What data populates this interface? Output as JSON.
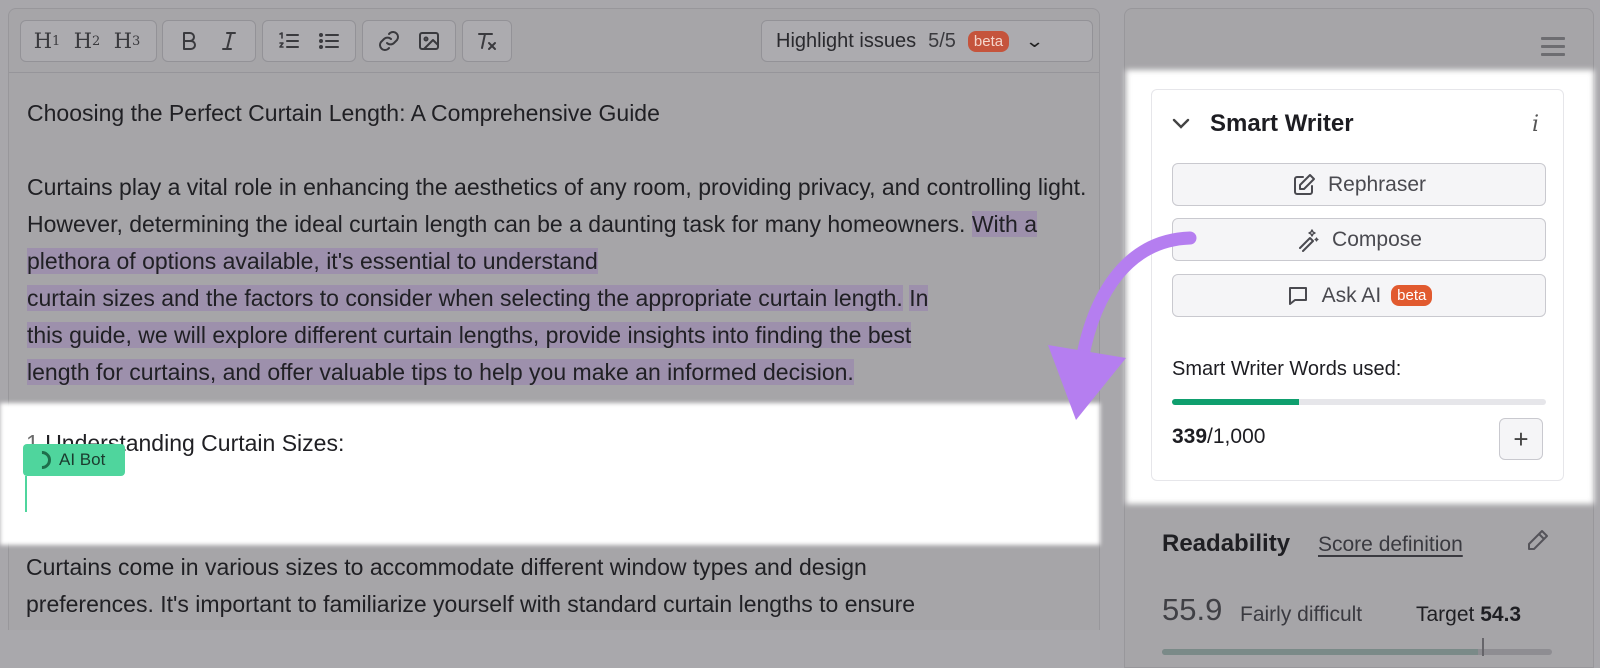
{
  "toolbar": {
    "headings": [
      {
        "main": "H",
        "sub": "1"
      },
      {
        "main": "H",
        "sub": "2"
      },
      {
        "main": "H",
        "sub": "3"
      }
    ],
    "highlight_label": "Highlight issues",
    "highlight_count": "5/5",
    "highlight_badge": "beta"
  },
  "document": {
    "title": "Choosing the Perfect Curtain Length: A Comprehensive Guide",
    "intro_plain": "Curtains play a vital role in enhancing the aesthetics of any room, providing privacy, and controlling light. However, determining the ideal curtain length can be a daunting task for many homeowners. ",
    "intro_hl1_part1": "With a plethora of options available, it's essential to understand",
    "intro_hl1_part2": "curtain sizes and the factors to consider when selecting the appropriate curtain length.",
    "intro_hl2_part1": "In",
    "intro_hl2_part2": "this guide, we will explore different curtain lengths, provide insights into finding the best",
    "intro_hl2_part3": "length for curtains, and offer valuable tips to help you make an informed decision.",
    "section_number": "1.",
    "section_heading": "Understanding Curtain Sizes:",
    "ai_bot_label": "AI Bot",
    "lower_line1": "Curtains come in various sizes to accommodate different window types and design",
    "lower_line2": "preferences. It's important to familiarize yourself with standard curtain lengths to ensure"
  },
  "smart_writer": {
    "title": "Smart Writer",
    "info_icon": "i",
    "rephraser_label": "Rephraser",
    "compose_label": "Compose",
    "ask_ai_label": "Ask AI",
    "ask_ai_badge": "beta",
    "words_used_label": "Smart Writer Words used:",
    "words_used": "339",
    "words_limit": "/1,000",
    "words_fraction": 0.339,
    "plus_label": "+"
  },
  "readability": {
    "title": "Readability",
    "score_definition_link": "Score definition",
    "score": "55.9",
    "score_label": "Fairly difficult",
    "target_label": "Target",
    "target_value": "54.3"
  },
  "colors": {
    "accent_purple": "#b57ef0",
    "ai_bot_green": "#4fd59d",
    "progress_green": "#0f9f6e",
    "beta_orange": "#e15a2f"
  }
}
